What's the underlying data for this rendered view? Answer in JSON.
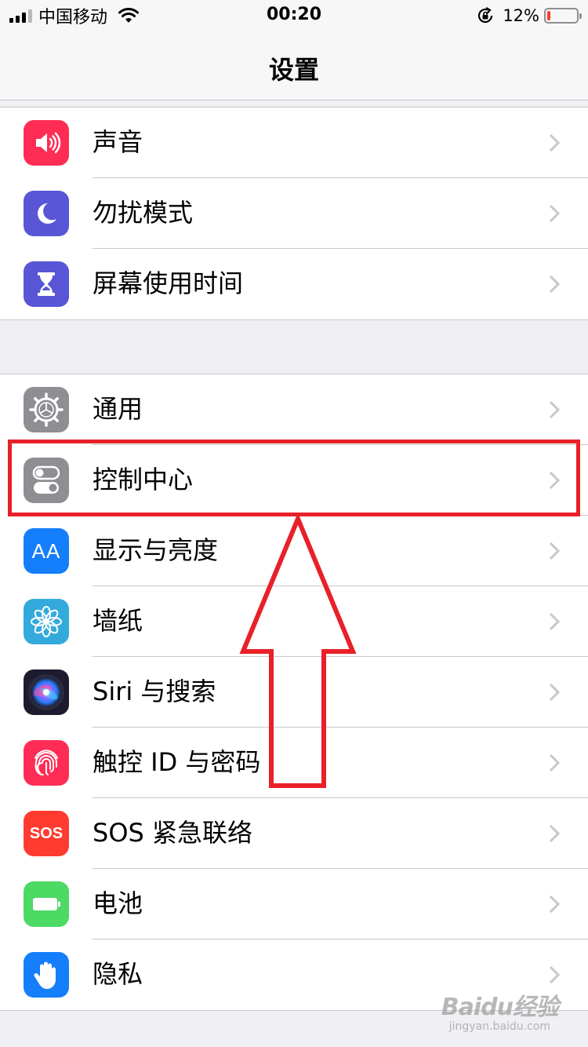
{
  "status_bar": {
    "carrier": "中国移动",
    "time": "00:20",
    "battery_percent": "12%",
    "battery_level": 0.12,
    "icons": [
      "signal-icon",
      "wifi-icon",
      "rotation-lock-icon",
      "battery-icon"
    ]
  },
  "nav": {
    "title": "设置"
  },
  "groups": [
    {
      "items": [
        {
          "label": "声音",
          "icon": "sound-icon",
          "color": "#ff2d55"
        },
        {
          "label": "勿扰模式",
          "icon": "moon-icon",
          "color": "#5856d6"
        },
        {
          "label": "屏幕使用时间",
          "icon": "hourglass-icon",
          "color": "#5856d6"
        }
      ]
    },
    {
      "items": [
        {
          "label": "通用",
          "icon": "gear-icon",
          "color": "#8e8e93"
        },
        {
          "label": "控制中心",
          "icon": "toggles-icon",
          "color": "#8e8e93"
        },
        {
          "label": "显示与亮度",
          "icon": "text-size-icon",
          "color": "#147efb"
        },
        {
          "label": "墙纸",
          "icon": "flower-icon",
          "color": "#34aadc"
        },
        {
          "label": "Siri 与搜索",
          "icon": "siri-icon",
          "color": "#1c1c2e"
        },
        {
          "label": "触控 ID 与密码",
          "icon": "fingerprint-icon",
          "color": "#ff2d55"
        },
        {
          "label": "SOS 紧急联络",
          "icon": "sos-icon",
          "color": "#ff3b30"
        },
        {
          "label": "电池",
          "icon": "battery-icon",
          "color": "#4cd964"
        },
        {
          "label": "隐私",
          "icon": "hand-icon",
          "color": "#147efb"
        }
      ]
    }
  ],
  "icon_text": {
    "text_size": "AA",
    "sos": "SOS"
  },
  "annotation": {
    "highlight_color": "#e8202a",
    "highlighted_item": "控制中心"
  },
  "watermark": {
    "logo": "Baidu经验",
    "url": "jingyan.baidu.com"
  }
}
